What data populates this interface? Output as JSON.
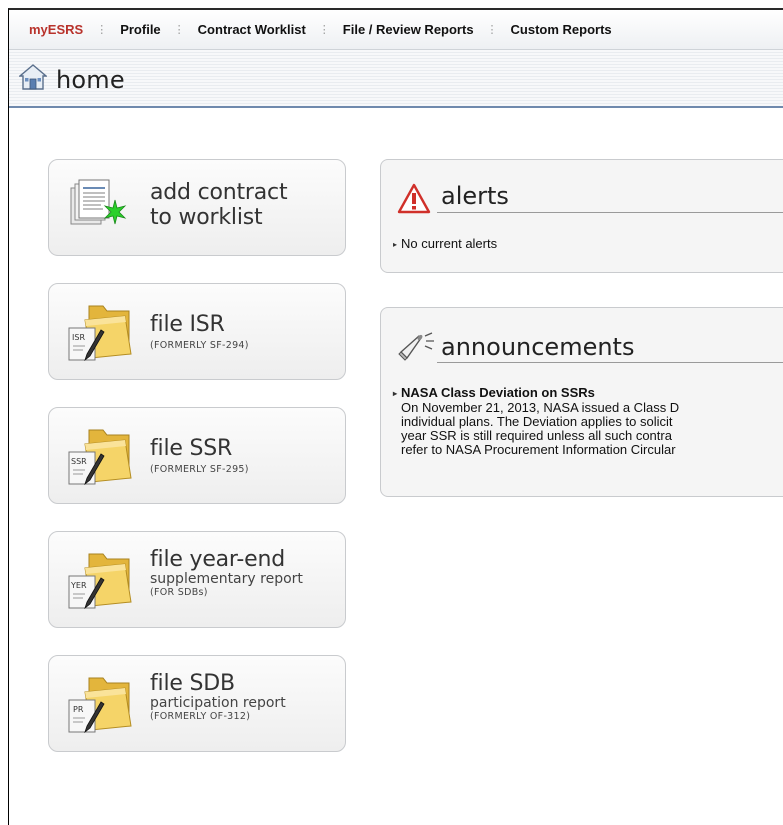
{
  "nav": {
    "items": [
      {
        "label": "myESRS"
      },
      {
        "label": "Profile"
      },
      {
        "label": "Contract Worklist"
      },
      {
        "label": "File / Review Reports"
      },
      {
        "label": "Custom Reports"
      }
    ]
  },
  "page": {
    "title": "home"
  },
  "tiles": [
    {
      "line1": "add contract",
      "line2": "to worklist",
      "icon": "add-contract-icon"
    },
    {
      "line1": "file ISR",
      "small": "(FORMERLY SF-294)",
      "badge": "ISR",
      "icon": "folder-isr-icon"
    },
    {
      "line1": "file SSR",
      "small": "(FORMERLY SF-295)",
      "badge": "SSR",
      "icon": "folder-ssr-icon"
    },
    {
      "line1": "file year-end",
      "line2": "supplementary report",
      "small": "(FOR SDBs)",
      "badge": "YER",
      "icon": "folder-yer-icon"
    },
    {
      "line1": "file SDB",
      "line2": "participation report",
      "small": "(FORMERLY OF-312)",
      "badge": "PR",
      "icon": "folder-pr-icon"
    }
  ],
  "alerts": {
    "heading": "alerts",
    "items": [
      "No current alerts"
    ]
  },
  "announcements": {
    "heading": "announcements",
    "items": [
      {
        "title": "NASA Class Deviation on SSRs",
        "lines": [
          "On November 21, 2013, NASA issued a Class D",
          "individual plans. The Deviation applies to solicit",
          "year SSR is still required unless all such contra",
          "refer to NASA Procurement Information Circular"
        ]
      }
    ]
  },
  "colors": {
    "nav_active": "#b8322b",
    "title_rule": "#6f89ad",
    "alert_red": "#d0302a",
    "folder_yellow": "#f2c94c"
  }
}
